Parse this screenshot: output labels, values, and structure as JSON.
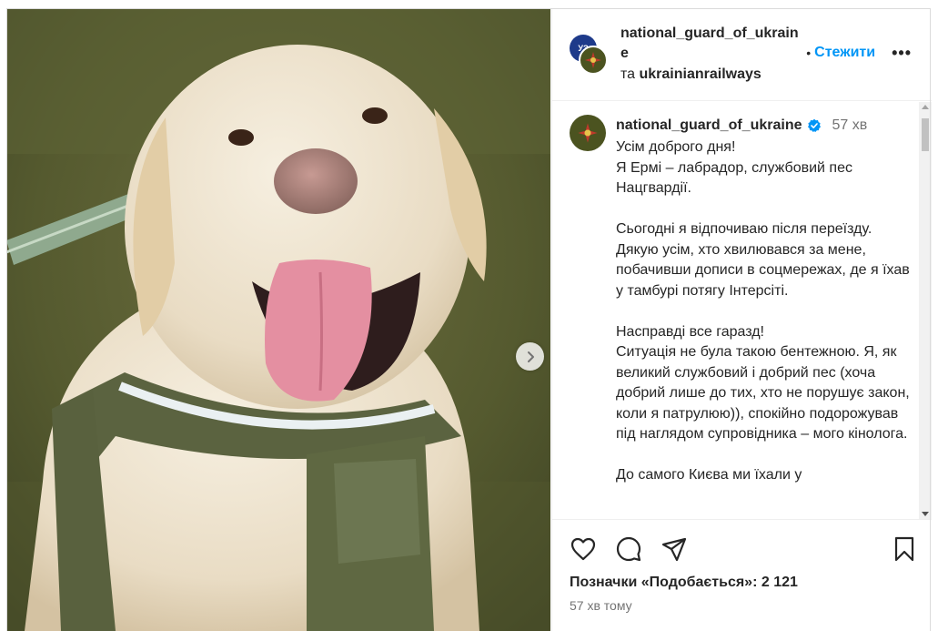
{
  "post": {
    "photo_alt": "",
    "next_icon": "chevron-right-icon"
  },
  "header": {
    "username": "national_guard_of_ukraine",
    "collab_prefix": "та",
    "collab_user": "ukrainianrailways",
    "separator": "•",
    "follow_label": "Стежити",
    "more_label": "•••",
    "back_avatar_text": "УЗ"
  },
  "caption": {
    "username": "national_guard_of_ukraine",
    "verified_icon": "verified-badge-icon",
    "time": "57 хв",
    "text": "Усім доброго дня!\nЯ Ермі – лабрадор, службовий пес Нацгвардії.\n\nСьогодні я відпочиваю після переїзду. Дякую усім, хто хвилювався за мене, побачивши дописи в соцмережах, де я їхав у тамбурі потягу Інтерсіті.\n\nНасправді все гаразд!\nСитуація не була такою бентежною. Я, як великий службовий і добрий пес (хоча добрий лише до тих, хто не порушує закон, коли я патрулюю)), спокійно подорожував під наглядом супровідника – мого кінолога.\n\nДо самого Києва ми їхали у"
  },
  "actions": {
    "like_icon": "heart-icon",
    "comment_icon": "comment-icon",
    "share_icon": "send-icon",
    "save_icon": "bookmark-icon",
    "likes_label": "Позначки «Подобається»:",
    "likes_count": "2 121",
    "time_ago": "57 хв тому"
  },
  "colors": {
    "link": "#0095f6",
    "muted": "#737373",
    "text": "#262626",
    "verified": "#0095f6"
  }
}
